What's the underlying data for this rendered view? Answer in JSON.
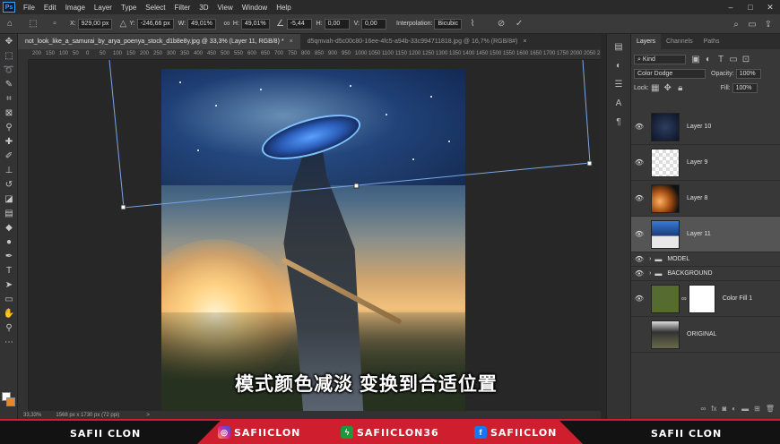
{
  "menubar": {
    "logo": "Ps",
    "items": [
      "File",
      "Edit",
      "Image",
      "Layer",
      "Type",
      "Select",
      "Filter",
      "3D",
      "View",
      "Window",
      "Help"
    ],
    "window_controls": [
      "–",
      "□",
      "✕"
    ]
  },
  "options": {
    "x_label": "X:",
    "x_value": "929,00 px",
    "y_label": "Y:",
    "y_value": "-246,66 px",
    "w_label": "W:",
    "w_value": "49,01%",
    "h_label": "H:",
    "h_value": "49,01%",
    "angle_value": "-5,44",
    "hskew_label": "H:",
    "hskew_value": "0,00",
    "vskew_label": "V:",
    "vskew_value": "0,00",
    "interp_label": "Interpolation:",
    "interp_value": "Bicubic"
  },
  "tabs": [
    {
      "label": "not_look_like_a_samurai_by_arya_poenya_stock_d1b8e8y.jpg @ 33,3% (Layer 11, RGB/8) *",
      "close": "×"
    },
    {
      "label": "d5qmvah-d5c00c80-16ee-4fc5-a94b-33c994711818.jpg @ 16,7% (RGB/8#)",
      "close": "×"
    }
  ],
  "ruler_ticks": [
    "200",
    "150",
    "100",
    "50",
    "0",
    "50",
    "100",
    "150",
    "200",
    "250",
    "300",
    "350",
    "400",
    "450",
    "500",
    "550",
    "600",
    "650",
    "700",
    "750",
    "800",
    "850",
    "900",
    "950",
    "1000",
    "1050",
    "1100",
    "1150",
    "1200",
    "1250",
    "1300",
    "1350",
    "1400",
    "1450",
    "1500",
    "1550",
    "1600",
    "1650",
    "1700",
    "1750",
    "2000",
    "2050",
    "2100",
    "2150",
    "2200"
  ],
  "canvas": {
    "subtitle": "模式颜色减淡 变换到合适位置"
  },
  "status": {
    "zoom": "33,33%",
    "doc": "1568 px x 1730 px (72 ppi)",
    "arrow": ">"
  },
  "panel": {
    "tabs": [
      "Layers",
      "Channels",
      "Paths"
    ],
    "kind_label": "Kind",
    "blend_mode": "Color Dodge",
    "opacity_label": "Opacity:",
    "opacity_value": "100%",
    "lock_label": "Lock:",
    "fill_label": "Fill:",
    "fill_value": "100%",
    "layers": [
      {
        "name": "Layer 10",
        "visible": true,
        "thumb": "#1a2540",
        "selected": false,
        "kind": "layer"
      },
      {
        "name": "Layer 9",
        "visible": true,
        "thumb": "checker",
        "selected": false,
        "kind": "layer"
      },
      {
        "name": "Layer 8",
        "visible": true,
        "thumb": "#c2621c",
        "selected": false,
        "kind": "layer"
      },
      {
        "name": "Layer 11",
        "visible": true,
        "thumb": "#2a5ea8",
        "selected": true,
        "kind": "layer"
      },
      {
        "name": "MODEL",
        "visible": true,
        "selected": false,
        "kind": "group"
      },
      {
        "name": "BACKGROUND",
        "visible": true,
        "selected": false,
        "kind": "group"
      },
      {
        "name": "Color Fill 1",
        "visible": true,
        "thumb": "#556b2f",
        "selected": false,
        "kind": "fill"
      },
      {
        "name": "ORIGINAL",
        "visible": false,
        "thumb": "#2c2c2c",
        "selected": false,
        "kind": "layer"
      }
    ]
  },
  "banner": {
    "left": "SAFII CLON",
    "instagram": "SAFIICLON",
    "other": "SAFIICLON36",
    "facebook": "SAFIICLON",
    "right": "SAFII CLON",
    "accent": "#cf1f2e"
  }
}
